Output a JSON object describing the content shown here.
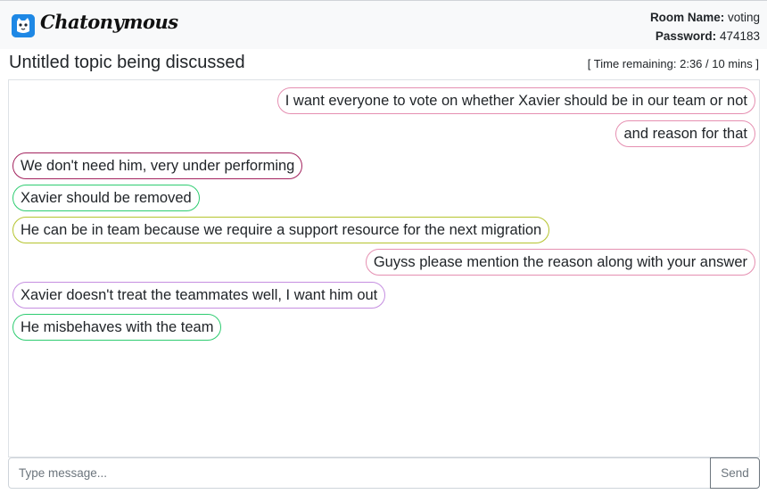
{
  "app": {
    "name": "Chatonymous",
    "logo_icon": "cat-face-icon",
    "accent": "#1e88e5"
  },
  "room": {
    "name_label": "Room Name:",
    "name_value": "voting",
    "password_label": "Password:",
    "password_value": "474183"
  },
  "topic": {
    "title": "Untitled topic being discussed"
  },
  "timer": {
    "text": "[ Time remaining: 2:36 / 10 mins ]"
  },
  "messages": [
    {
      "text": "I want everyone to vote on whether Xavier should be in our team or not",
      "side": "right",
      "border": "#e58fb1"
    },
    {
      "text": "and reason for that",
      "side": "right",
      "border": "#e58fb1"
    },
    {
      "text": "We don't need him, very under performing",
      "side": "left",
      "border": "#a3235e"
    },
    {
      "text": "Xavier should be removed",
      "side": "left",
      "border": "#2ecc71"
    },
    {
      "text": "He can be in team because we require a support resource for the next migration",
      "side": "left",
      "border": "#b5c42e"
    },
    {
      "text": "Guyss please mention the reason along with your answer",
      "side": "right",
      "border": "#e58fb1"
    },
    {
      "text": "Xavier doesn't treat the teammates well, I want him out",
      "side": "left",
      "border": "#c58ee0"
    },
    {
      "text": "He misbehaves with the team",
      "side": "left",
      "border": "#2ecc71"
    }
  ],
  "composer": {
    "placeholder": "Type message...",
    "send_label": "Send"
  }
}
